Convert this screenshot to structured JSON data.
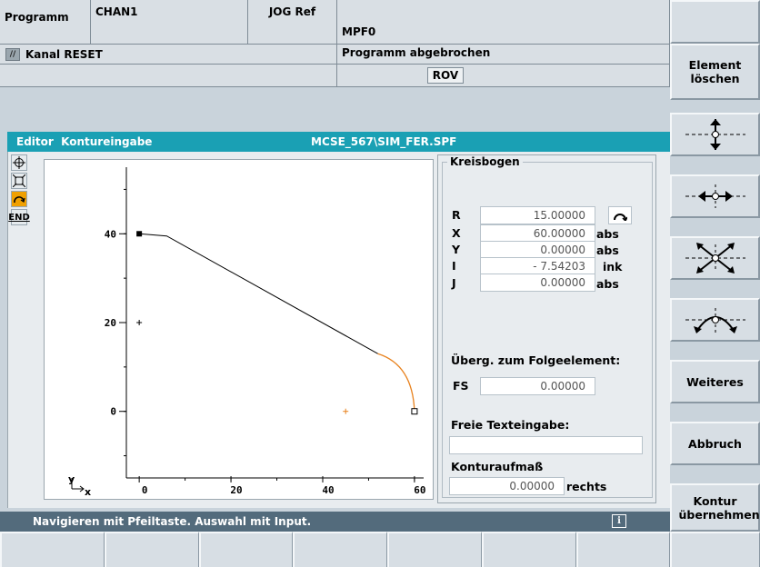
{
  "header": {
    "mode": "Programm",
    "channel": "CHAN1",
    "jog": "JOG Ref",
    "program": "MPF0",
    "channel_status": "Kanal RESET",
    "program_status": "Programm abgebrochen",
    "rov": "ROV"
  },
  "editor": {
    "title": "Editor  Kontureingabe",
    "file": "MCSE_567\\SIM_FER.SPF",
    "side_icons": [
      "crosshair-icon",
      "zoom-fit-icon",
      "arc-cw-icon",
      "END"
    ]
  },
  "chart_data": {
    "type": "line",
    "xticks": [
      "0",
      "20",
      "40",
      "60"
    ],
    "yticks": [
      "40",
      "20",
      "0"
    ],
    "xlim": [
      -3,
      62
    ],
    "ylim": [
      -15,
      55
    ],
    "axis_x_label": "x",
    "axis_y_label": "y",
    "series": [
      {
        "segment": "line",
        "points": [
          [
            0,
            40
          ],
          [
            6,
            39.5
          ],
          [
            52,
            13
          ]
        ]
      },
      {
        "segment": "arc",
        "points": [
          [
            52,
            13
          ],
          [
            60,
            0
          ]
        ],
        "selected": true
      }
    ],
    "start_point": [
      0,
      40
    ],
    "end_point": [
      60,
      0
    ],
    "markers": [
      [
        0,
        20
      ],
      [
        45,
        0
      ]
    ],
    "colors": {
      "line": "#000000",
      "arc": "#e8821e",
      "marker": "#e8821e"
    }
  },
  "form": {
    "group_title": "Kreisbogen",
    "rows": [
      {
        "label": "R",
        "value": "15.00000",
        "unit": ""
      },
      {
        "label": "X",
        "value": "60.00000",
        "unit": "abs"
      },
      {
        "label": "Y",
        "value": "0.00000",
        "unit": "abs"
      },
      {
        "label": "I",
        "value": "- 7.54203",
        "unit": "ink"
      },
      {
        "label": "J",
        "value": "0.00000",
        "unit": "abs"
      }
    ],
    "direction_icon": "arc-direction-icon",
    "transition_label": "Überg. zum Folgeelement:",
    "fs_label": "FS",
    "fs_value": "0.00000",
    "free_text_label": "Freie Texteingabe:",
    "free_text_value": "",
    "allowance_label": "Konturaufmaß",
    "allowance_value": "0.00000",
    "allowance_side": "rechts"
  },
  "status": {
    "message": "Navigieren mit Pfeiltaste. Auswahl mit Input.",
    "info_icon": "i"
  },
  "softkeys": {
    "element_loeschen": "Element löschen",
    "weiteres": "Weiteres",
    "abbruch": "Abbruch",
    "kontur_uebernehmen": "Kontur übernehmen"
  },
  "colors": {
    "title_bar": "#1aa0b4",
    "status_bar": "#536b7c",
    "selected_icon": "#f0a000"
  }
}
